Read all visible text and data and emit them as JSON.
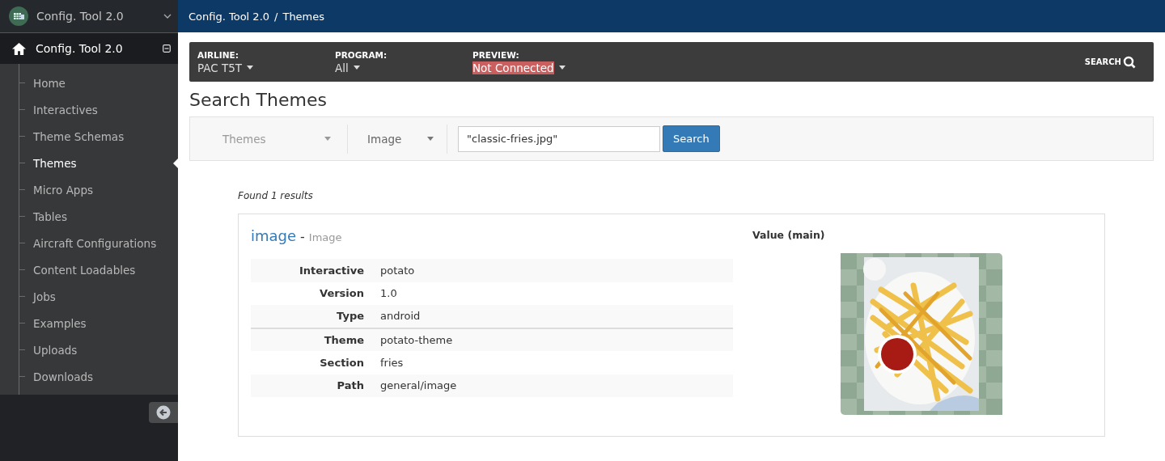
{
  "app_switcher": {
    "title": "Config. Tool 2.0"
  },
  "sidebar": {
    "root": {
      "label": "Config. Tool 2.0",
      "expanded": true
    },
    "items": [
      {
        "label": "Home",
        "selected": false
      },
      {
        "label": "Interactives",
        "selected": false
      },
      {
        "label": "Theme Schemas",
        "selected": false
      },
      {
        "label": "Themes",
        "selected": true
      },
      {
        "label": "Micro Apps",
        "selected": false
      },
      {
        "label": "Tables",
        "selected": false
      },
      {
        "label": "Aircraft Configurations",
        "selected": false
      },
      {
        "label": "Content Loadables",
        "selected": false
      },
      {
        "label": "Jobs",
        "selected": false
      },
      {
        "label": "Examples",
        "selected": false
      },
      {
        "label": "Uploads",
        "selected": false
      },
      {
        "label": "Downloads",
        "selected": false
      }
    ]
  },
  "breadcrumb": {
    "items": [
      "Config. Tool 2.0",
      "Themes"
    ],
    "separator": "/"
  },
  "filters": [
    {
      "label": "AIRLINE:",
      "value": "PAC T5T",
      "alert": false
    },
    {
      "label": "PROGRAM:",
      "value": "All",
      "alert": false
    },
    {
      "label": "PREVIEW:",
      "value": "Not Connected",
      "alert": true
    }
  ],
  "filter_search": "SEARCH",
  "page_title": "Search Themes",
  "search_bar": {
    "scope": "Themes",
    "category": "Image",
    "query": "\"classic-fries.jpg\"",
    "button": "Search"
  },
  "results": {
    "summary": "Found 1 results",
    "items": [
      {
        "name": "image",
        "separator": "-",
        "type": "Image",
        "groups": [
          [
            {
              "label": "Interactive",
              "value": "potato"
            },
            {
              "label": "Version",
              "value": "1.0"
            },
            {
              "label": "Type",
              "value": "android"
            }
          ],
          [
            {
              "label": "Theme",
              "value": "potato-theme"
            },
            {
              "label": "Section",
              "value": "fries"
            },
            {
              "label": "Path",
              "value": "general/image"
            }
          ]
        ],
        "value_label": "Value (main)",
        "preview": {
          "kind": "picture"
        }
      }
    ]
  }
}
